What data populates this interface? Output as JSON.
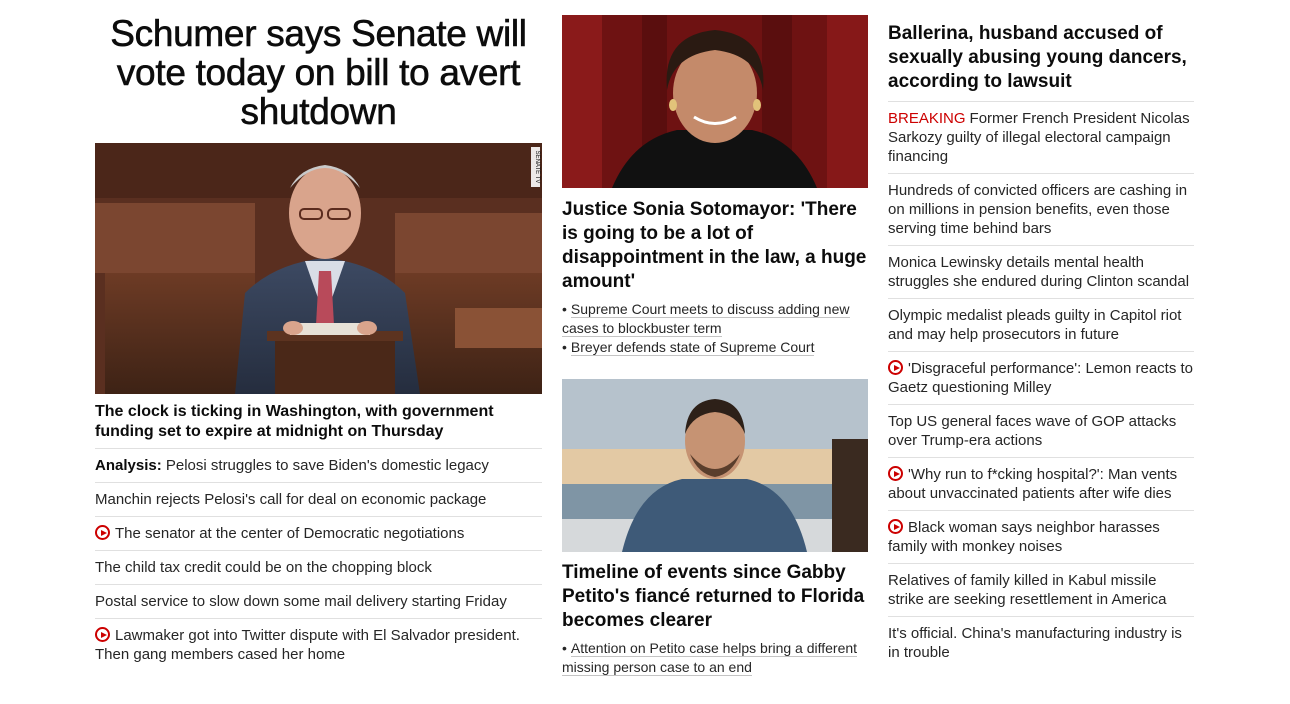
{
  "col1": {
    "headline": "Schumer says Senate will vote today on bill to avert shutdown",
    "image_watermark": "SENATE TV",
    "caption": "The clock is ticking in Washington, with government funding set to expire at midnight on Thursday",
    "stories": [
      {
        "prefix": "Analysis:",
        "text": "Pelosi struggles to save Biden's domestic legacy",
        "video": false
      },
      {
        "prefix": "",
        "text": "Manchin rejects Pelosi's call for deal on economic package",
        "video": false
      },
      {
        "prefix": "",
        "text": "The senator at the center of Democratic negotiations",
        "video": true
      },
      {
        "prefix": "",
        "text": "The child tax credit could be on the chopping block",
        "video": false
      },
      {
        "prefix": "",
        "text": "Postal service to slow down some mail delivery starting Friday",
        "video": false
      },
      {
        "prefix": "",
        "text": "Lawmaker got into Twitter dispute with El Salvador president. Then gang members cased her home",
        "video": true
      }
    ]
  },
  "col2": {
    "story1": {
      "headline": "Justice Sonia Sotomayor: 'There is going to be a lot of disappointment in the law, a huge amount'",
      "bullet": "•",
      "links": [
        "Supreme Court meets to discuss adding new cases to blockbuster term",
        "Breyer defends state of Supreme Court"
      ]
    },
    "story2": {
      "headline": "Timeline of events since Gabby Petito's fiancé returned to Florida becomes clearer",
      "bullet": "•",
      "links": [
        "Attention on Petito case helps bring a different missing person case to an end"
      ]
    }
  },
  "col3": {
    "headline": "Ballerina, husband accused of sexually abusing young dancers, according to lawsuit",
    "stories": [
      {
        "label": "BREAKING",
        "text": "Former French President Nicolas Sarkozy guilty of illegal electoral campaign financing",
        "video": false
      },
      {
        "label": "",
        "text": "Hundreds of convicted officers are cashing in on millions in pension benefits, even those serving time behind bars",
        "video": false
      },
      {
        "label": "",
        "text": "Monica Lewinsky details mental health struggles she endured during Clinton scandal",
        "video": false
      },
      {
        "label": "",
        "text": "Olympic medalist pleads guilty in Capitol riot and may help prosecutors in future",
        "video": false
      },
      {
        "label": "",
        "text": "'Disgraceful performance': Lemon reacts to Gaetz questioning Milley",
        "video": true
      },
      {
        "label": "",
        "text": "Top US general faces wave of GOP attacks over Trump-era actions",
        "video": false
      },
      {
        "label": "",
        "text": "'Why run to f*cking hospital?': Man vents about unvaccinated patients after wife dies",
        "video": true
      },
      {
        "label": "",
        "text": "Black woman says neighbor harasses family with monkey noises",
        "video": true
      },
      {
        "label": "",
        "text": "Relatives of family killed in Kabul missile strike are seeking resettlement in America",
        "video": false
      },
      {
        "label": "",
        "text": "It's official. China's manufacturing industry is in trouble",
        "video": false
      }
    ]
  },
  "colors": {
    "breaking": "#cc0000",
    "video_icon": "#cc0000",
    "headline": "#0c0c0c",
    "divider": "#e0e0e0"
  }
}
